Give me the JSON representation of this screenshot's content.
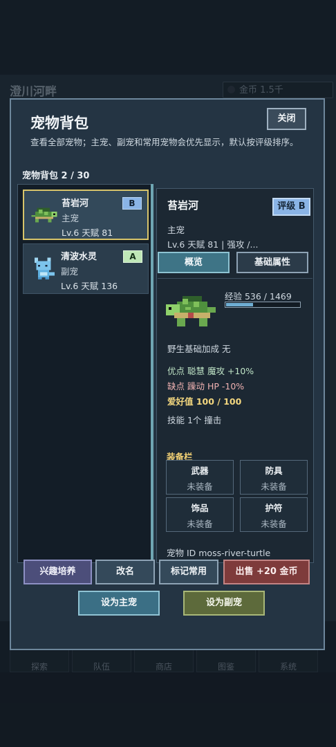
{
  "background": {
    "location_name": "澄川河畔",
    "gold_label": "金币 1.5千",
    "nav_tabs": [
      "探索",
      "队伍",
      "商店",
      "图鉴",
      "系统"
    ]
  },
  "modal": {
    "title": "宠物背包",
    "close_label": "关闭",
    "description": "查看全部宠物；主宠、副宠和常用宠物会优先显示，默认按评级排序。",
    "bag_count_label": "宠物背包  2 / 30"
  },
  "pet_list": [
    {
      "name": "苔岩河",
      "role": "主宠",
      "stats": "Lv.6  天赋 81",
      "grade": "B",
      "selected": true,
      "sprite": "turtle-sprite"
    },
    {
      "name": "清波水灵",
      "role": "副宠",
      "stats": "Lv.6  天赋 136",
      "grade": "A",
      "selected": false,
      "sprite": "water-spirit-sprite"
    }
  ],
  "detail": {
    "name": "苔岩河",
    "grade_label": "评级 B",
    "role": "主宠",
    "stats_line": "Lv.6  天赋 81 | 强攻 /...",
    "tabs": {
      "overview": "概览",
      "basic": "基础属性"
    },
    "exp_label": "经验  536 / 1469",
    "exp_current": 536,
    "exp_max": 1469,
    "wild_bonus": "野生基础加成  无",
    "strengths": "优点  聪慧  魔攻 +10%",
    "weaknesses": "缺点  躁动  HP -10%",
    "affection": "爱好值  100 / 100",
    "skills": "技能  1个  撞击",
    "equip_title": "装备栏",
    "equipment": [
      {
        "slot": "武器",
        "value": "未装备"
      },
      {
        "slot": "防具",
        "value": "未装备"
      },
      {
        "slot": "饰品",
        "value": "未装备"
      },
      {
        "slot": "护符",
        "value": "未装备"
      }
    ],
    "pet_id": "宠物 ID  moss-river-turtle"
  },
  "actions": {
    "cultivate": "兴趣培养",
    "rename": "改名",
    "mark_favorite": "标记常用",
    "sell": "出售 +20 金币",
    "set_main": "设为主宠",
    "set_sub": "设为副宠"
  },
  "colors": {
    "modal_bg": "#243443",
    "selected_border": "#d8c46a",
    "grade_b": "#8ab4e6",
    "grade_a": "#bfe7b7",
    "sell_button": "#7e3b3b",
    "set_main_button": "#3b6f85",
    "set_sub_button": "#5d6a3b",
    "equip_title": "#f0cf74"
  }
}
